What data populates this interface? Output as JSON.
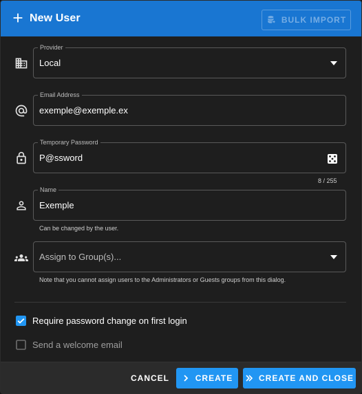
{
  "header": {
    "title": "New User",
    "bulk_import_label": "BULK IMPORT"
  },
  "form": {
    "provider": {
      "label": "Provider",
      "value": "Local"
    },
    "email": {
      "label": "Email Address",
      "value": "exemple@exemple.ex"
    },
    "password": {
      "label": "Temporary Password",
      "value": "P@ssword",
      "counter": "8 / 255"
    },
    "name": {
      "label": "Name",
      "value": "Exemple",
      "hint": "Can be changed by the user."
    },
    "groups": {
      "placeholder": "Assign to Group(s)...",
      "hint": "Note that you cannot assign users to the Administrators or Guests groups from this dialog."
    }
  },
  "options": {
    "require_password_change": {
      "label": "Require password change on first login",
      "checked": true
    },
    "send_welcome_email": {
      "label": "Send a welcome email",
      "checked": false
    }
  },
  "footer": {
    "cancel_label": "CANCEL",
    "create_label": "CREATE",
    "create_close_label": "CREATE AND CLOSE"
  },
  "colors": {
    "accent": "#1976d2",
    "button_blue": "#2196f3",
    "checkbox_checked": "#2196f3"
  }
}
